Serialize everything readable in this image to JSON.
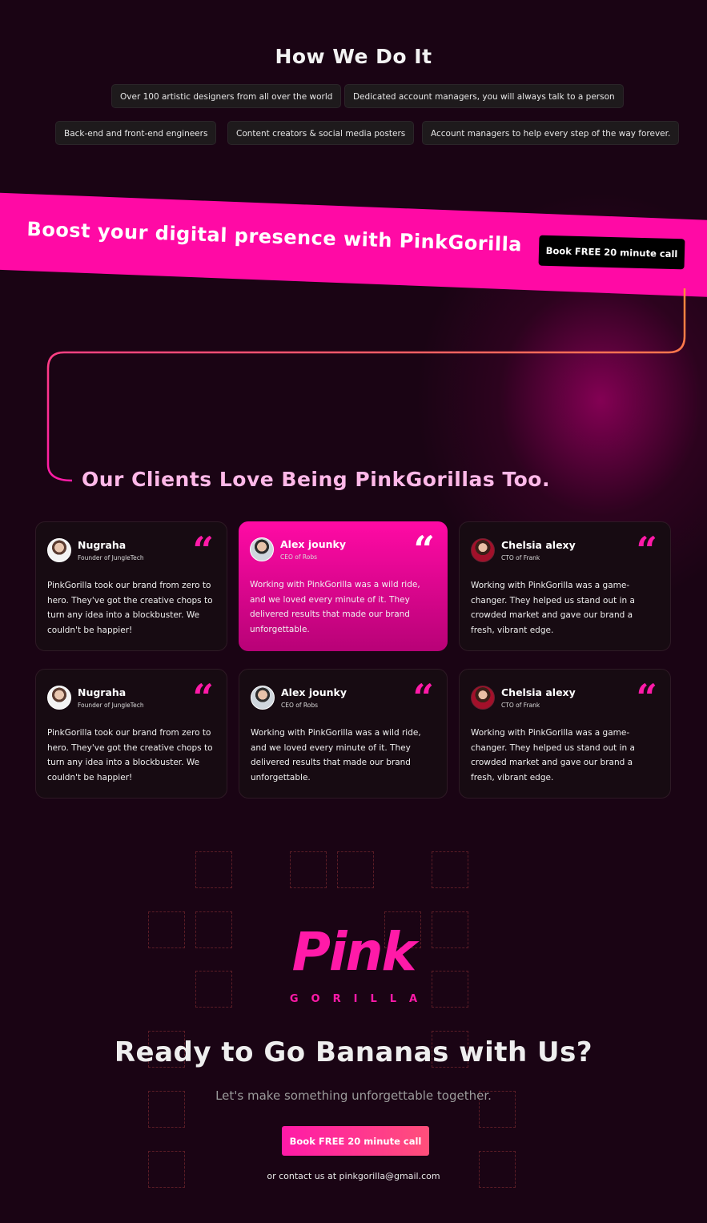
{
  "how": {
    "title": "How We Do It",
    "pills": [
      "Over 100 artistic designers from all over the world",
      "Dedicated account managers, you will always talk to a person",
      "Back-end and front-end engineers",
      "Content creators & social media posters",
      "Account managers to help every step of the way forever."
    ]
  },
  "banner": {
    "text": "Boost your digital presence with PinkGorilla",
    "button": "Book FREE 20 minute call"
  },
  "clients": {
    "title": "Our Clients Love Being PinkGorillas Too.",
    "cards": [
      {
        "name": "Nugraha",
        "role": "Founder of JungleTech",
        "text": "PinkGorilla took our brand from zero to hero. They've got the creative chops to turn any idea into a blockbuster. We couldn't be happier!"
      },
      {
        "name": "Alex jounky",
        "role": "CEO of Robs",
        "text": "Working with PinkGorilla was a wild ride, and we loved every minute of it. They delivered results that made our brand unforgettable."
      },
      {
        "name": "Chelsia alexy",
        "role": "CTO of Frank",
        "text": "Working with PinkGorilla was a game-changer. They helped us stand out in a crowded market and gave our brand a fresh, vibrant edge."
      },
      {
        "name": "Nugraha",
        "role": "Founder of JungleTech",
        "text": "PinkGorilla took our brand from zero to hero. They've got the creative chops to turn any idea into a blockbuster. We couldn't be happier!"
      },
      {
        "name": "Alex jounky",
        "role": "CEO of Robs",
        "text": "Working with PinkGorilla was a wild ride, and we loved every minute of it. They delivered results that made our brand unforgettable."
      },
      {
        "name": "Chelsia alexy",
        "role": "CTO of Frank",
        "text": "Working with PinkGorilla was a game-changer. They helped us stand out in a crowded market and gave our brand a fresh, vibrant edge."
      }
    ],
    "quote_glyph": "“"
  },
  "logo": {
    "word": "Pink",
    "sub": "GORILLA"
  },
  "cta": {
    "title": "Ready to Go Bananas with Us?",
    "subtitle": "Let's make something unforgettable together.",
    "button": "Book FREE 20 minute call",
    "contact": "or contact us at pinkgorilla@gmail.com"
  },
  "colors": {
    "brand_pink": "#ff0aa5",
    "background": "#1a0414",
    "accent_orange": "#ff7a3a"
  }
}
